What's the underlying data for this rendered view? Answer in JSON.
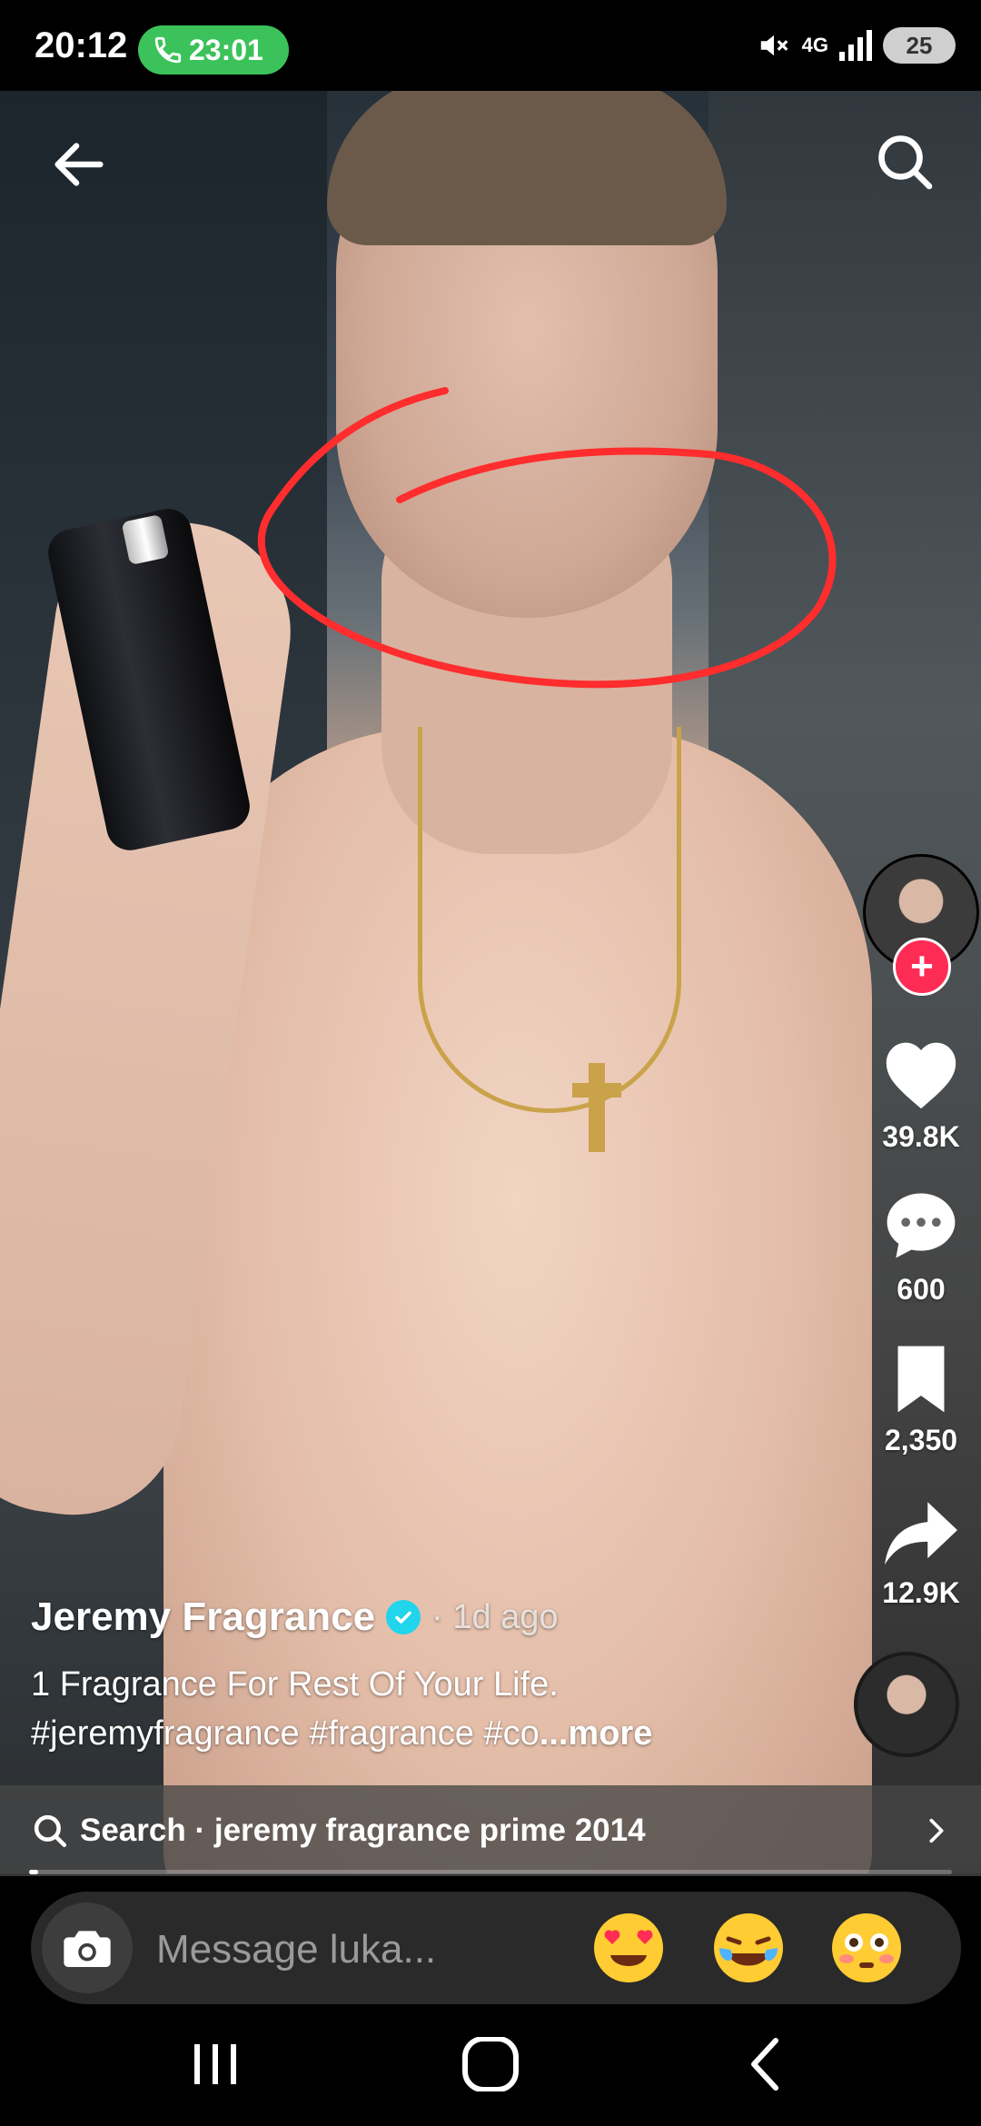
{
  "status_bar": {
    "time": "20:12",
    "call_duration": "23:01",
    "network": "4G",
    "battery": "25"
  },
  "video": {
    "annotation_color": "#ff2d2d"
  },
  "rail": {
    "likes": "39.8K",
    "comments": "600",
    "saves": "2,350",
    "shares": "12.9K"
  },
  "caption": {
    "author": "Jeremy Fragrance",
    "time_ago": "· 1d ago",
    "line1": "1 Fragrance For Rest Of Your Life.",
    "line2": "#jeremyfragrance #fragrance #co",
    "more": "...more"
  },
  "search_suggestion": {
    "text": "Search · jeremy fragrance prime 2014"
  },
  "progress": 0.01,
  "message": {
    "placeholder": "Message luka..."
  },
  "icons": {
    "emoji_1": "heart-eyes-emoji",
    "emoji_2": "tears-of-joy-emoji",
    "emoji_3": "flushed-emoji"
  },
  "colors": {
    "accent": "#fe2c55",
    "verified": "#20d5ec",
    "call": "#3cc25a"
  }
}
